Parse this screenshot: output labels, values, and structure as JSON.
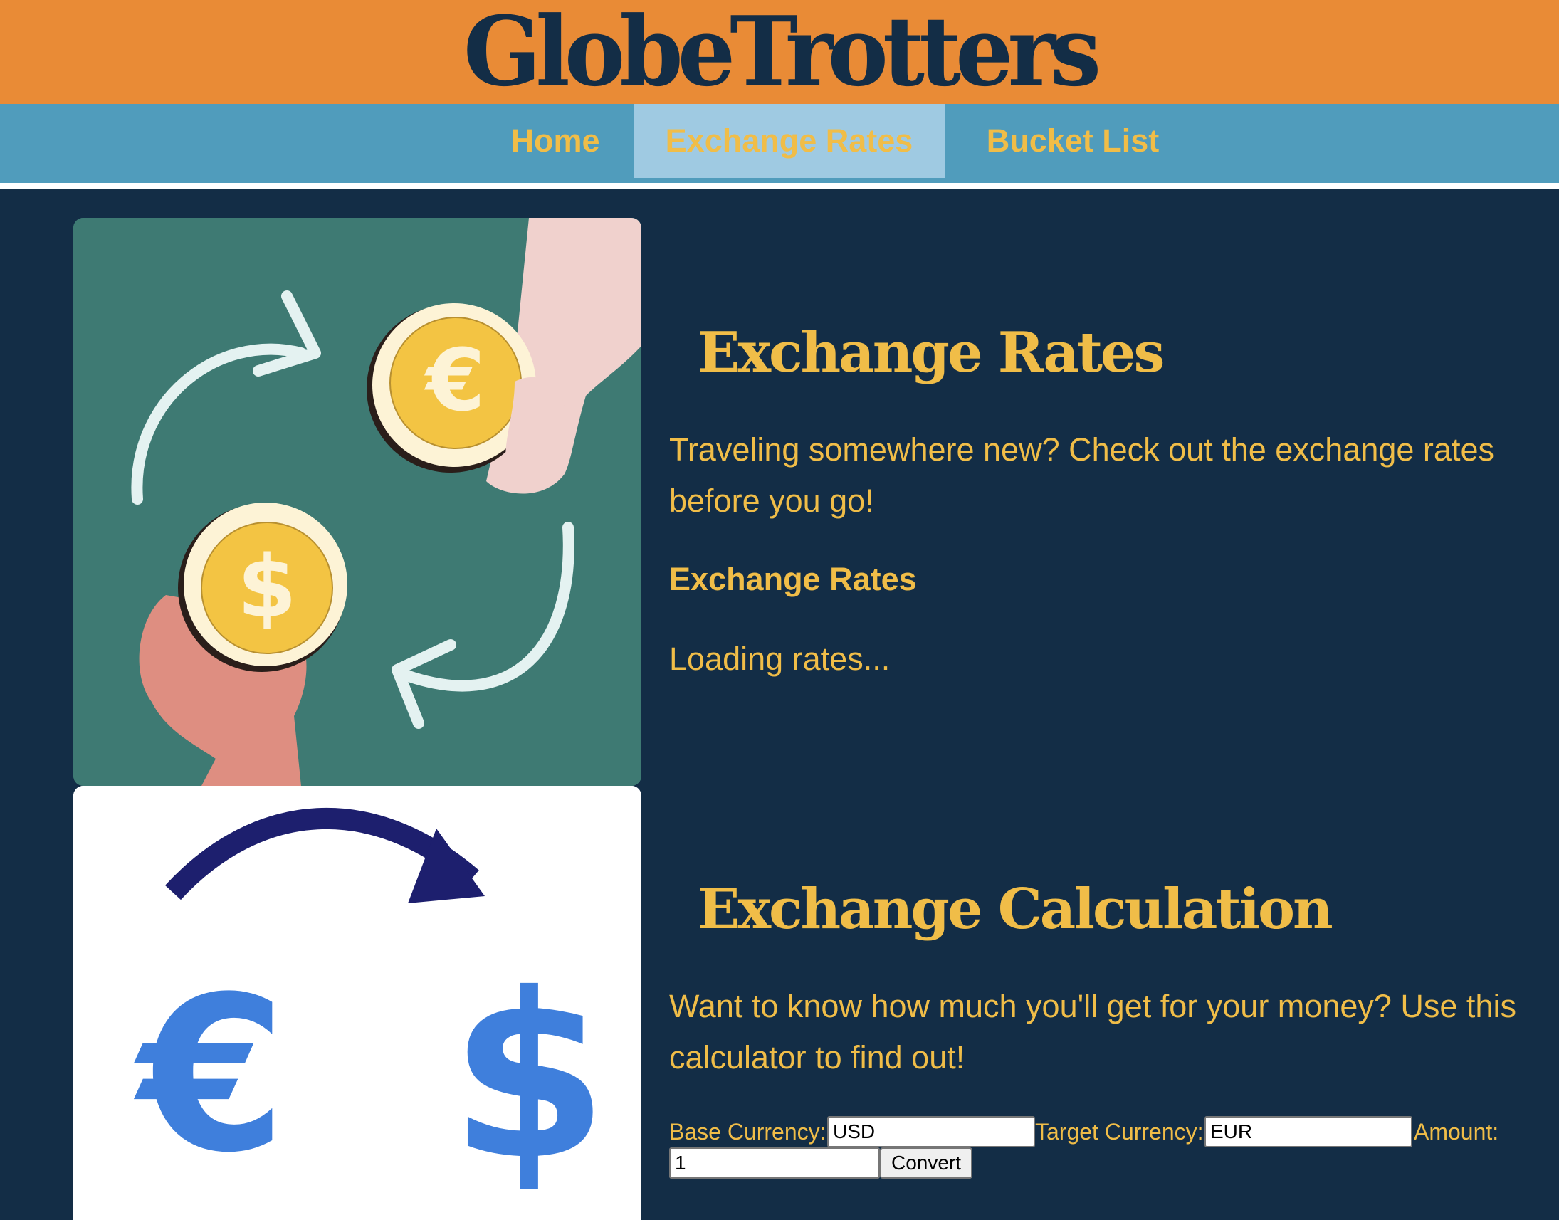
{
  "header": {
    "brand": "GlobeTrotters"
  },
  "nav": {
    "items": [
      {
        "label": "Home"
      },
      {
        "label": "Exchange Rates",
        "active": true
      },
      {
        "label": "Bucket List"
      }
    ]
  },
  "rates_section": {
    "title": "Exchange Rates",
    "intro": "Traveling somewhere new? Check out the exchange rates before you go!",
    "subheading": "Exchange Rates",
    "status": "Loading rates..."
  },
  "calc_section": {
    "title": "Exchange Calculation",
    "intro": "Want to know how much you'll get for your money? Use this calculator to find out!",
    "base_label": "Base Currency:",
    "base_value": "USD",
    "target_label": "Target Currency:",
    "target_value": "EUR",
    "amount_label": "Amount:",
    "amount_value": "1",
    "convert_label": "Convert"
  },
  "colors": {
    "header_bg": "#e98b36",
    "nav_bg": "#509cbc",
    "nav_active_bg": "#9fcae2",
    "page_bg": "#132d46",
    "accent_text": "#f0bd48"
  }
}
